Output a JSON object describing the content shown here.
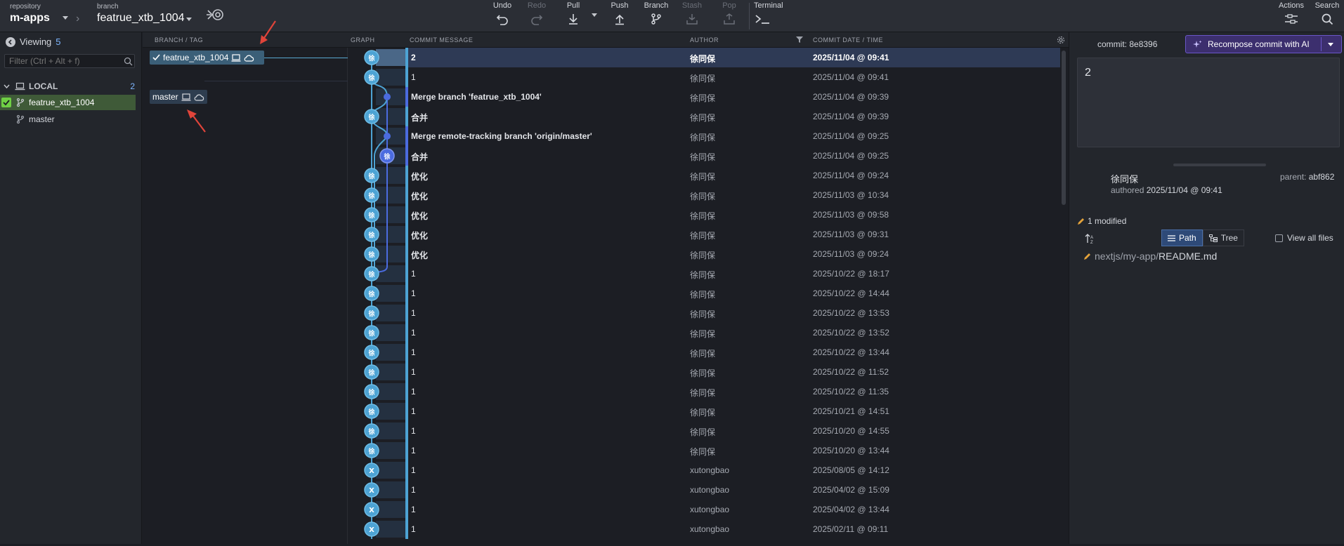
{
  "header": {
    "repo_label": "repository",
    "repo_name": "m-apps",
    "branch_label": "branch",
    "branch_name": "featrue_xtb_1004",
    "actions": {
      "undo": "Undo",
      "redo": "Redo",
      "pull": "Pull",
      "push": "Push",
      "branch": "Branch",
      "stash": "Stash",
      "pop": "Pop",
      "terminal": "Terminal",
      "right_actions": "Actions",
      "search": "Search"
    }
  },
  "left_panel": {
    "viewing_label": "Viewing",
    "viewing_count": "5",
    "filter_placeholder": "Filter (Ctrl + Alt + f)",
    "local_label": "LOCAL",
    "local_count": "2",
    "branches": [
      {
        "name": "featrue_xtb_1004",
        "active": true
      },
      {
        "name": "master",
        "active": false
      }
    ]
  },
  "columns": {
    "branch_tag": "BRANCH / TAG",
    "graph": "GRAPH",
    "message": "COMMIT MESSAGE",
    "author": "AUTHOR",
    "date": "COMMIT DATE / TIME"
  },
  "branch_tags": {
    "current": "featrue_xtb_1004",
    "master": "master"
  },
  "commits": [
    {
      "msg": "2",
      "author": "徐同保",
      "date": "2025/11/04 @ 09:41",
      "avatar": "徐"
    },
    {
      "msg": "1",
      "author": "徐同保",
      "date": "2025/11/04 @ 09:41",
      "avatar": "徐"
    },
    {
      "msg": "Merge branch 'featrue_xtb_1004'",
      "author": "徐同保",
      "date": "2025/11/04 @ 09:39",
      "avatar": ""
    },
    {
      "msg": "合并",
      "author": "徐同保",
      "date": "2025/11/04 @ 09:39",
      "avatar": "徐"
    },
    {
      "msg": "Merge remote-tracking branch 'origin/master'",
      "author": "徐同保",
      "date": "2025/11/04 @ 09:25",
      "avatar": ""
    },
    {
      "msg": "合并",
      "author": "徐同保",
      "date": "2025/11/04 @ 09:25",
      "avatar": "徐"
    },
    {
      "msg": "优化",
      "author": "徐同保",
      "date": "2025/11/04 @ 09:24",
      "avatar": "徐"
    },
    {
      "msg": "优化",
      "author": "徐同保",
      "date": "2025/11/03 @ 10:34",
      "avatar": "徐"
    },
    {
      "msg": "优化",
      "author": "徐同保",
      "date": "2025/11/03 @ 09:58",
      "avatar": "徐"
    },
    {
      "msg": "优化",
      "author": "徐同保",
      "date": "2025/11/03 @ 09:31",
      "avatar": "徐"
    },
    {
      "msg": "优化",
      "author": "徐同保",
      "date": "2025/11/03 @ 09:24",
      "avatar": "徐"
    },
    {
      "msg": "1",
      "author": "徐同保",
      "date": "2025/10/22 @ 18:17",
      "avatar": "徐"
    },
    {
      "msg": "1",
      "author": "徐同保",
      "date": "2025/10/22 @ 14:44",
      "avatar": "徐"
    },
    {
      "msg": "1",
      "author": "徐同保",
      "date": "2025/10/22 @ 13:53",
      "avatar": "徐"
    },
    {
      "msg": "1",
      "author": "徐同保",
      "date": "2025/10/22 @ 13:52",
      "avatar": "徐"
    },
    {
      "msg": "1",
      "author": "徐同保",
      "date": "2025/10/22 @ 13:44",
      "avatar": "徐"
    },
    {
      "msg": "1",
      "author": "徐同保",
      "date": "2025/10/22 @ 11:52",
      "avatar": "徐"
    },
    {
      "msg": "1",
      "author": "徐同保",
      "date": "2025/10/22 @ 11:35",
      "avatar": "徐"
    },
    {
      "msg": "1",
      "author": "徐同保",
      "date": "2025/10/21 @ 14:51",
      "avatar": "徐"
    },
    {
      "msg": "1",
      "author": "徐同保",
      "date": "2025/10/20 @ 14:55",
      "avatar": "徐"
    },
    {
      "msg": "1",
      "author": "徐同保",
      "date": "2025/10/20 @ 13:44",
      "avatar": "徐"
    },
    {
      "msg": "1",
      "author": "xutongbao",
      "date": "2025/08/05 @ 14:12",
      "avatar": "X"
    },
    {
      "msg": "1",
      "author": "xutongbao",
      "date": "2025/04/02 @ 15:09",
      "avatar": "X"
    },
    {
      "msg": "1",
      "author": "xutongbao",
      "date": "2025/04/02 @ 13:44",
      "avatar": "X"
    },
    {
      "msg": "1",
      "author": "xutongbao",
      "date": "2025/02/11 @ 09:11",
      "avatar": "X"
    }
  ],
  "details": {
    "commit_label": "commit:",
    "commit_sha": "8e8396",
    "recompose_label": "Recompose commit with AI",
    "message": "2",
    "author": "徐同保",
    "authored_label": "authored",
    "authored_date": "2025/11/04 @ 09:41",
    "parent_label": "parent:",
    "parent_sha": "abf862",
    "modified": "1 modified",
    "path_label": "Path",
    "tree_label": "Tree",
    "view_all": "View all files",
    "file_dir": "nextjs/my-app/",
    "file_name": "README.md"
  },
  "colors": {
    "accent_blue": "#4da3d4",
    "merge_blue": "#4b6bdf",
    "selected_row": "#2e3a55",
    "recompose_purple": "#3c2f6e",
    "arrow_red": "#e0443a"
  }
}
